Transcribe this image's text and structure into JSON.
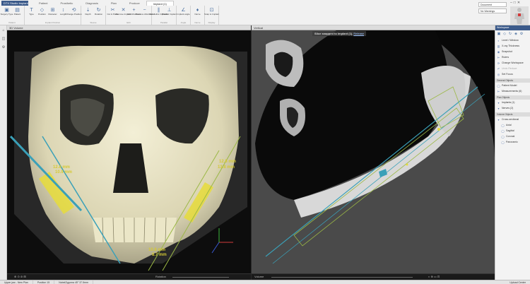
{
  "app": {
    "title": "SICAT Suite Implant",
    "menu_label": "DTX Studio Implant"
  },
  "tabs": [
    "Patient",
    "Prosthetic",
    "Diagnosis",
    "Plan",
    "Produce",
    "Implant (1)"
  ],
  "active_tab": 5,
  "ribbon": {
    "groups": [
      {
        "label": "Patient",
        "tools": [
          {
            "icon": "▣",
            "name": "surgery-icon",
            "label": "Surgery Type"
          },
          {
            "icon": "▤",
            "name": "patient-icon",
            "label": "Patient"
          }
        ]
      },
      {
        "label": "Implant Position",
        "tools": [
          {
            "icon": "T",
            "name": "type-icon",
            "label": "Type"
          },
          {
            "icon": "◇",
            "name": "position-icon",
            "label": "Position"
          },
          {
            "icon": "⊞",
            "name": "diameter-icon",
            "label": "Diameter"
          },
          {
            "icon": "↕",
            "name": "length-icon",
            "label": "Length"
          },
          {
            "icon": "⟲",
            "name": "change-position-icon",
            "label": "Change Position"
          }
        ]
      },
      {
        "label": "Sleeve",
        "tools": [
          {
            "icon": "⇣",
            "name": "depth-icon",
            "label": "Depth"
          },
          {
            "icon": "↻",
            "name": "rotation-icon",
            "label": "Rotation"
          }
        ]
      },
      {
        "label": "Edit",
        "tools": [
          {
            "icon": "✂",
            "name": "cut-paste-icon",
            "label": "Cut & Paste"
          },
          {
            "icon": "✕",
            "name": "remove-implant-icon",
            "label": "Remove Implant"
          },
          {
            "icon": "+",
            "name": "add-abutment-icon",
            "label": "Add Abutment"
          },
          {
            "icon": "−",
            "name": "remove-abutment-icon",
            "label": "Remove Abutment"
          }
        ]
      },
      {
        "label": "Parallel",
        "tools": [
          {
            "icon": "∥",
            "name": "parallelize-icon",
            "label": "Parallelize Implants"
          },
          {
            "icon": "⊥",
            "name": "parallel-implant-icon",
            "label": "Parallel Implant"
          }
        ]
      },
      {
        "label": "Angle",
        "tools": [
          {
            "icon": "∠",
            "name": "implant-angle-icon",
            "label": "Implant angle"
          }
        ]
      },
      {
        "label": "Nerve",
        "tools": [
          {
            "icon": "♦",
            "name": "nerve-icon",
            "label": "Nerve"
          }
        ]
      },
      {
        "label": "Display",
        "tools": [
          {
            "icon": "⊡",
            "name": "snap-implant-icon",
            "label": "Snap to Implant"
          }
        ]
      }
    ]
  },
  "top_right": {
    "field1": "Document",
    "field2": "No Warnings"
  },
  "viewports": {
    "left": {
      "title": "3D Volume",
      "measurements": [
        "12.8 mm",
        "10.9 mm",
        "12.8 mm",
        "13.8 mm",
        "10.8 mm",
        "8.7 mm"
      ],
      "footer_label": "Rotation"
    },
    "right": {
      "title": "Vertical",
      "notice": "Slice snapped to implant (1).",
      "notice_link": "Release",
      "footer_label": "Volume"
    }
  },
  "panel": {
    "header": "Workspace",
    "tools": [
      "▣",
      "◇",
      "↻",
      "◈",
      "⚙"
    ],
    "actions": [
      {
        "icon": "◐",
        "name": "level-window-icon",
        "label": "Level / Window"
      },
      {
        "icon": "▥",
        "name": "xray-thickness-icon",
        "label": "X-ray Thickness"
      },
      {
        "icon": "◉",
        "name": "snapshot-icon",
        "label": "Snapshot"
      },
      {
        "icon": "⊢",
        "name": "rulers-icon",
        "label": "Rulers"
      },
      {
        "icon": "⟳",
        "name": "change-workspace-icon",
        "label": "Change Workspace"
      },
      {
        "icon": "↶",
        "name": "undo-icon",
        "label": "Undo Reduce",
        "dim": true
      },
      {
        "icon": "◎",
        "name": "set-focus-icon",
        "label": "Set Focus"
      }
    ],
    "sections": [
      {
        "title": "General Objects",
        "items": [
          {
            "icon": "◯",
            "name": "patient-model-icon",
            "label": "Patient Model"
          },
          {
            "icon": "⊢",
            "name": "measurements-icon",
            "label": "Measurements (6)"
          }
        ]
      },
      {
        "title": "Plan Objects",
        "items": [
          {
            "icon": "▾",
            "name": "implants-icon",
            "label": "Implants (1)"
          },
          {
            "icon": "▾",
            "name": "nerves-icon",
            "label": "Nerves (2)"
          }
        ]
      },
      {
        "title": "Volume Objects",
        "items": [
          {
            "icon": "▾",
            "name": "cross-sectional-icon",
            "label": "Cross-sectional"
          },
          {
            "icon": "◯",
            "name": "axial-icon",
            "label": "Axial",
            "indent": true
          },
          {
            "icon": "◯",
            "name": "sagittal-icon",
            "label": "Sagittal",
            "indent": true
          },
          {
            "icon": "◯",
            "name": "coronal-icon",
            "label": "Coronal",
            "indent": true
          },
          {
            "icon": "◯",
            "name": "panoramic-icon",
            "label": "Panoramic",
            "indent": true
          }
        ]
      }
    ]
  },
  "status": {
    "jaw": "Upper jaw - New Plan",
    "position": "Position 15",
    "implant": "NobelZygoma 45° 37.5mm",
    "upload": "Upload Center"
  },
  "colors": {
    "measurement": "#d5c936",
    "implant": "#3aa0b8",
    "guide": "#9bb845",
    "accent": "#3b5a8a"
  }
}
